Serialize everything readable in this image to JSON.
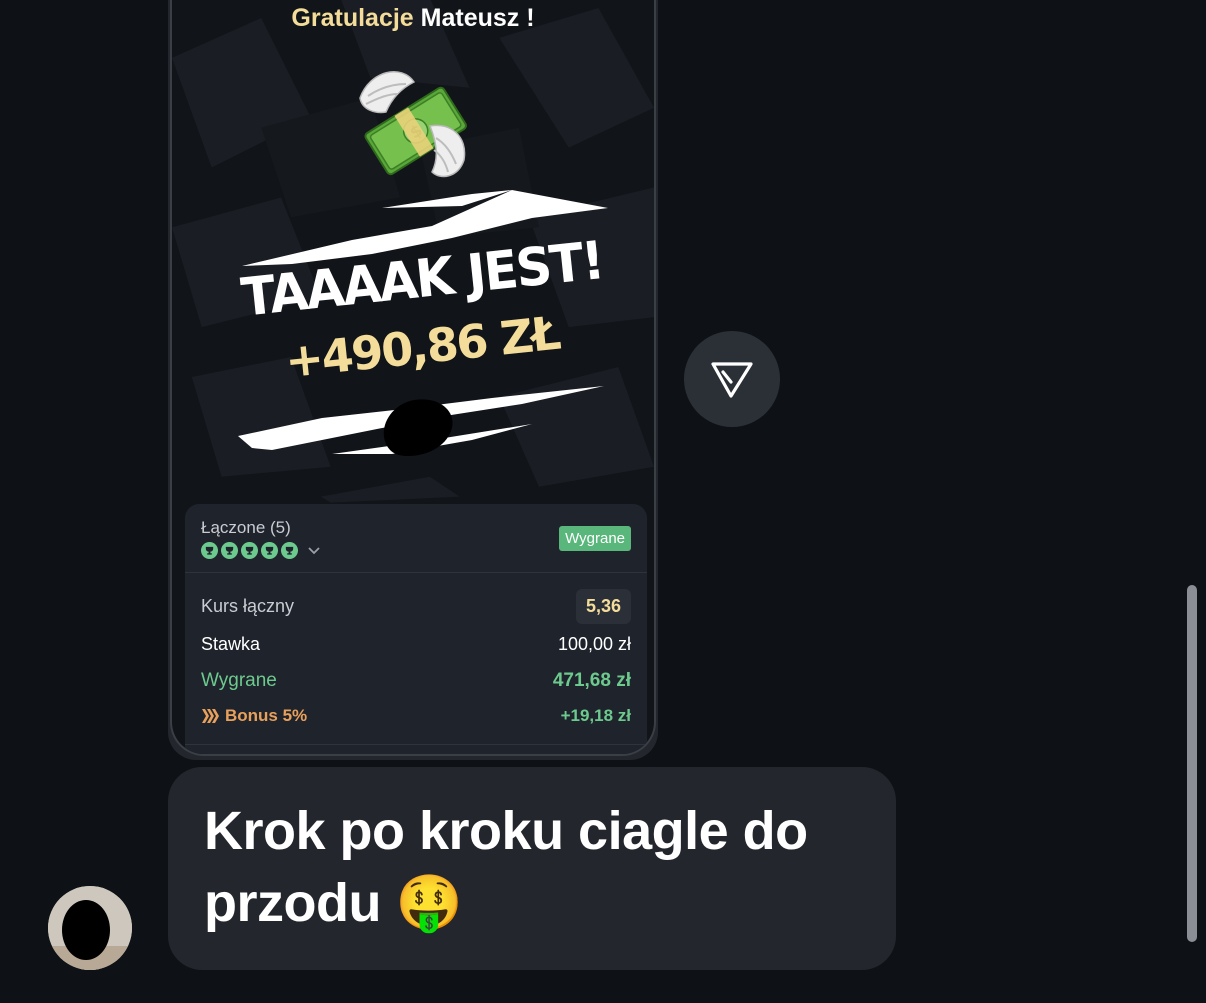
{
  "card": {
    "greeting_prefix": "Gratulacje",
    "greeting_name": "Mateusz !",
    "headline": "TAAAAK JEST!",
    "amount": "+490,86 ZŁ"
  },
  "bet": {
    "type": "Łączone (5)",
    "status": "Wygrane",
    "legs_won": 5,
    "odds_label": "Kurs łączny",
    "odds_value": "5,36",
    "stake_label": "Stawka",
    "stake_value": "100,00 zł",
    "win_label": "Wygrane",
    "win_value": "471,68 zł",
    "bonus_label": "Bonus 5%",
    "bonus_value": "+19,18 zł"
  },
  "message": {
    "text": "Krok po kroku ciagle do przodu 🤑"
  },
  "icons": {
    "forward": "forward-share-icon",
    "money": "money-with-wings-icon",
    "trophy": "trophy-icon",
    "chevron": "chevron-down-icon",
    "bonus": "bonus-chevrons-icon"
  },
  "colors": {
    "background": "#0e1216",
    "bubble": "#23272d",
    "gold": "#f4dd9a",
    "green": "#6dca8e",
    "orange": "#e8a15c"
  }
}
